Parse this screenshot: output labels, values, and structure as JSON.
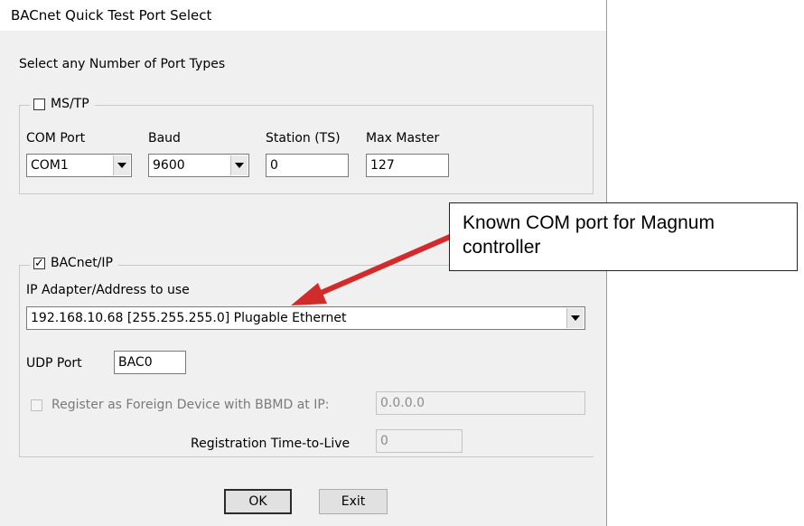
{
  "window": {
    "title": "BACnet Quick Test Port Select"
  },
  "instruction": "Select any Number of Port Types",
  "mstp": {
    "checkbox_label": "MS/TP",
    "checked": false,
    "com_port_label": "COM Port",
    "com_port_value": "COM1",
    "baud_label": "Baud",
    "baud_value": "9600",
    "station_label": "Station (TS)",
    "station_value": "0",
    "max_master_label": "Max Master",
    "max_master_value": "127"
  },
  "bacnet_ip": {
    "checkbox_label": "BACnet/IP",
    "checked": true,
    "checkmark": "✓",
    "adapter_label": "IP Adapter/Address to use",
    "adapter_value": "192.168.10.68 [255.255.255.0]  Plugable Ethernet",
    "udp_label": "UDP Port",
    "udp_value": "BAC0",
    "foreign_label": "Register as Foreign Device with BBMD at IP:",
    "foreign_checked": false,
    "bbmd_ip_value": "0.0.0.0",
    "ttl_label": "Registration Time-to-Live",
    "ttl_value": "0"
  },
  "buttons": {
    "ok": "OK",
    "exit": "Exit"
  },
  "annotation": {
    "text": "Known COM port for Magnum controller",
    "arrow_color": "#d22b2b"
  }
}
